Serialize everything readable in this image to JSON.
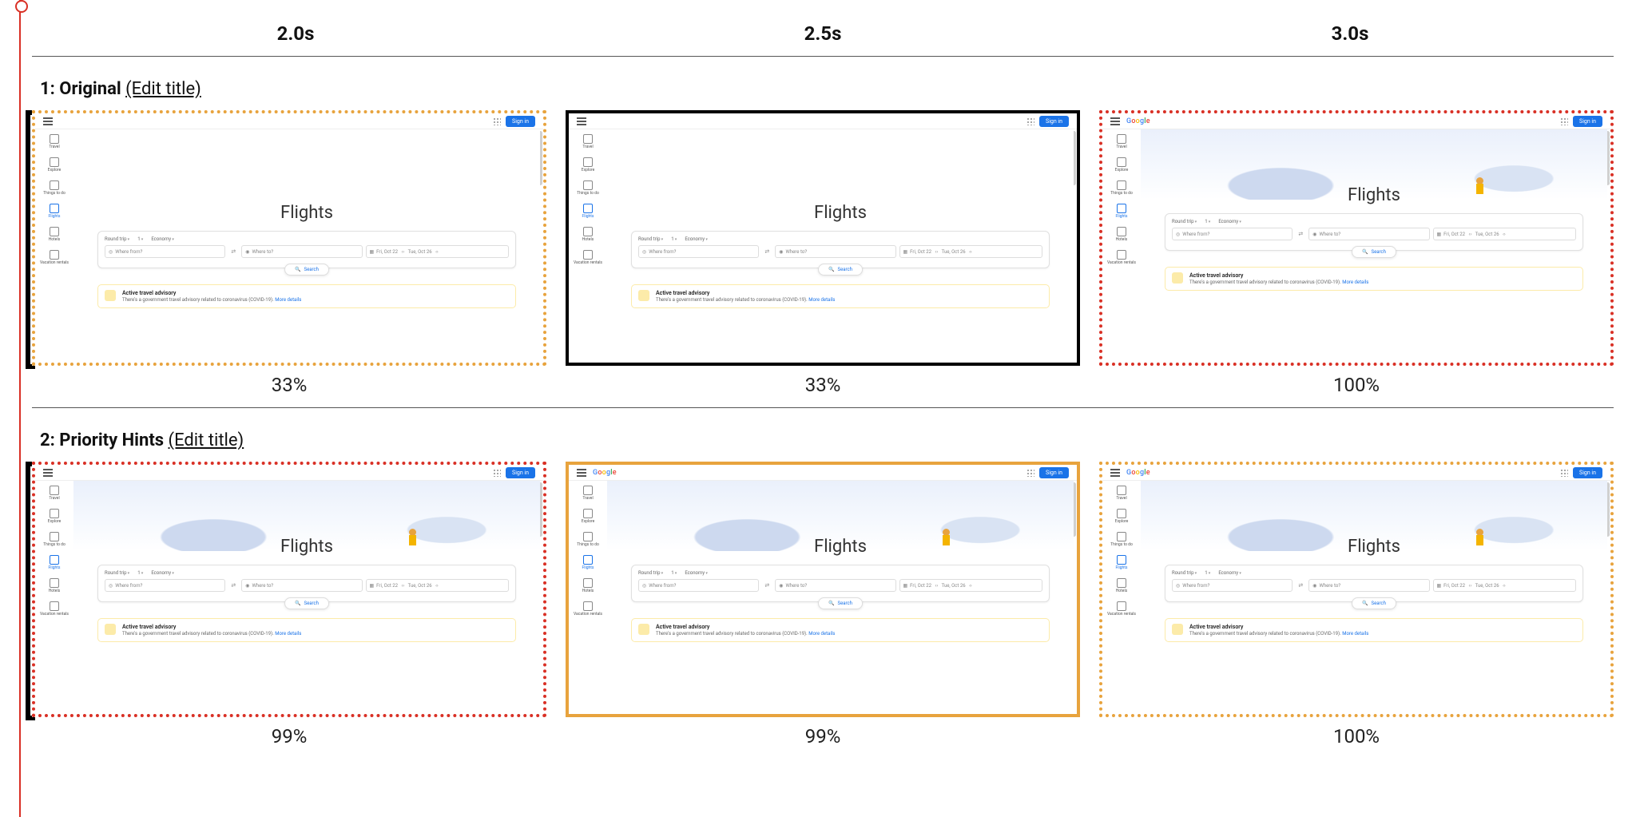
{
  "times": [
    "2.0s",
    "2.5s",
    "3.0s"
  ],
  "edit_title_label": "(Edit title)",
  "runs": [
    {
      "index": "1",
      "name": "Original",
      "frames": [
        {
          "border": "border-dotted-orange",
          "hero_loaded": false,
          "show_logo": false,
          "pct": "33%"
        },
        {
          "border": "border-solid-black",
          "hero_loaded": false,
          "show_logo": false,
          "pct": "33%"
        },
        {
          "border": "border-dotted-red",
          "hero_loaded": true,
          "show_logo": true,
          "pct": "100%"
        }
      ]
    },
    {
      "index": "2",
      "name": "Priority Hints",
      "frames": [
        {
          "border": "border-dotted-red",
          "hero_loaded": true,
          "show_logo": false,
          "pct": "99%"
        },
        {
          "border": "border-solid-orange",
          "hero_loaded": true,
          "show_logo": true,
          "pct": "99%"
        },
        {
          "border": "border-dotted-orange",
          "hero_loaded": true,
          "show_logo": true,
          "pct": "100%"
        }
      ]
    }
  ],
  "thumb": {
    "logo_letters": [
      "G",
      "o",
      "o",
      "g",
      "l",
      "e"
    ],
    "signin": "Sign in",
    "title": "Flights",
    "sidebar": [
      "Travel",
      "Explore",
      "Things to do",
      "Flights",
      "Hotels",
      "Vacation rentals"
    ],
    "sidebar_active_index": 3,
    "opts": [
      "Round trip",
      "1",
      "Economy"
    ],
    "from_placeholder": "Where from?",
    "to_placeholder": "Where to?",
    "date1": "Fri, Oct 22",
    "date2": "Tue, Oct 26",
    "search": "Search",
    "advisory_title": "Active travel advisory",
    "advisory_body": "There's a government travel advisory related to coronavirus (COVID-19).",
    "advisory_link": "More details"
  }
}
